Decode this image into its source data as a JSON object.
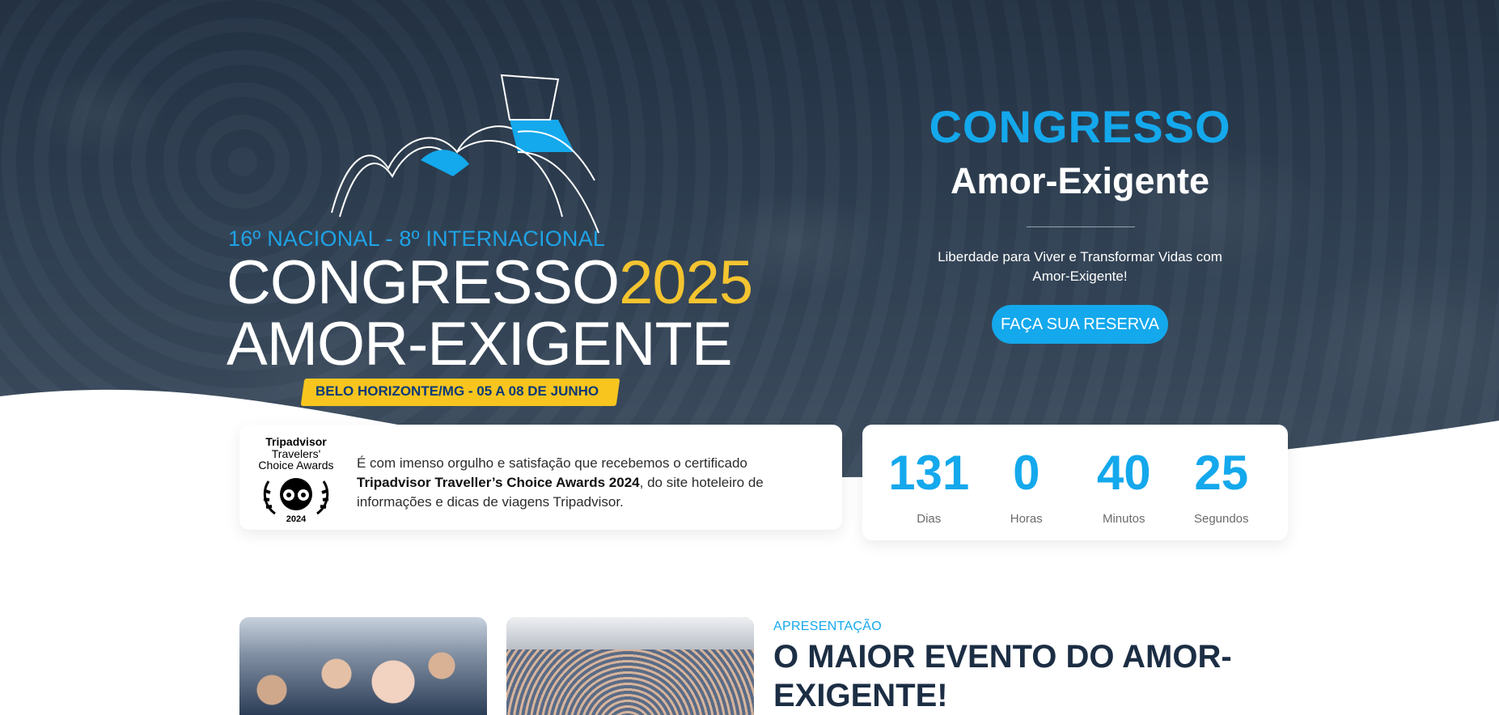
{
  "hero": {
    "logo": {
      "subtitle": "16º NACIONAL - 8º INTERNACIONAL",
      "line1_word": "CONGRESSO",
      "line1_year": "2025",
      "line2": "AMOR-EXIGENTE",
      "banner": "BELO HORIZONTE/MG - 05 A 08 DE JUNHO"
    },
    "title": "CONGRESSO",
    "subtitle": "Amor-Exigente",
    "tagline": "Liberdade para Viver e Transformar Vidas com Amor-Exigente!",
    "cta_label": "FAÇA SUA RESERVA"
  },
  "award": {
    "logo_line1": "Tripadvisor",
    "logo_line2": "Travelers'",
    "logo_line3": "Choice Awards",
    "logo_year": "2024",
    "text_before": "É com imenso orgulho e satisfação que recebemos o certificado ",
    "text_bold": "Tripadvisor Traveller’s Choice Awards 2024",
    "text_after": ", do site hoteleiro de informações e dicas de viagens Tripadvisor."
  },
  "countdown": [
    {
      "value": "131",
      "label": "Dias"
    },
    {
      "value": "0",
      "label": "Horas"
    },
    {
      "value": "40",
      "label": "Minutos"
    },
    {
      "value": "25",
      "label": "Segundos"
    }
  ],
  "presentation": {
    "eyebrow": "APRESENTAÇÃO",
    "title": "O MAIOR EVENTO DO AMOR-EXIGENTE!"
  },
  "colors": {
    "accent": "#14a8ec",
    "yellow": "#f7c51e",
    "dark": "#1c2e44"
  }
}
